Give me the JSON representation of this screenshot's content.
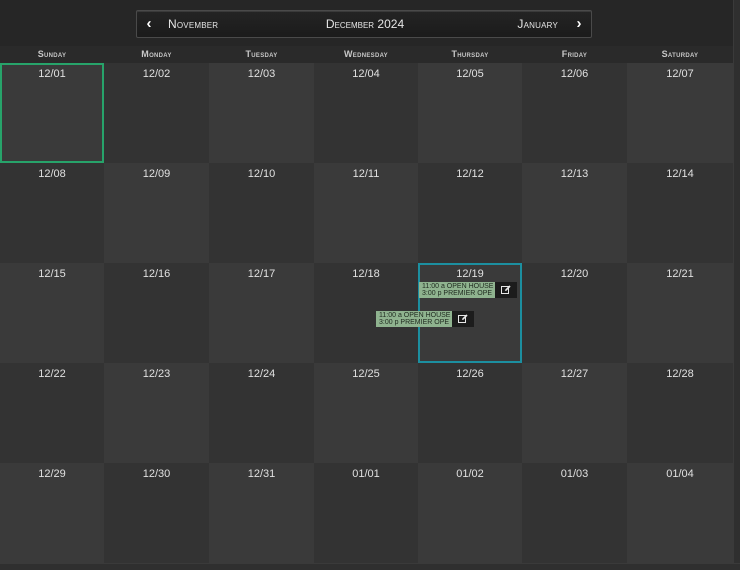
{
  "nav": {
    "prev_arrow": "‹",
    "prev_label": "November",
    "title": "December 2024",
    "next_label": "January",
    "next_arrow": "›"
  },
  "weekdays": [
    "Sunday",
    "Monday",
    "Tuesday",
    "Wednesday",
    "Thursday",
    "Friday",
    "Saturday"
  ],
  "weeks": [
    [
      "12/01",
      "12/02",
      "12/03",
      "12/04",
      "12/05",
      "12/06",
      "12/07"
    ],
    [
      "12/08",
      "12/09",
      "12/10",
      "12/11",
      "12/12",
      "12/13",
      "12/14"
    ],
    [
      "12/15",
      "12/16",
      "12/17",
      "12/18",
      "12/19",
      "12/20",
      "12/21"
    ],
    [
      "12/22",
      "12/23",
      "12/24",
      "12/25",
      "12/26",
      "12/27",
      "12/28"
    ],
    [
      "12/29",
      "12/30",
      "12/31",
      "01/01",
      "01/02",
      "01/03",
      "01/04"
    ]
  ],
  "today": "12/01",
  "highlighted": "12/19",
  "events": [
    {
      "line1": "11:00 a OPEN HOUSE",
      "line2": "3:00 p PREMIER OPE",
      "edit_icon": "edit-icon"
    },
    {
      "line1": "11:00 a OPEN HOUSE",
      "line2": "3:00 p PREMIER OPE",
      "edit_icon": "edit-icon"
    }
  ],
  "colors": {
    "background": "#2c2c2c",
    "today_outline": "#27a36a",
    "highlight_outline": "#1c8fa0",
    "event_fill": "#8fb38f"
  }
}
